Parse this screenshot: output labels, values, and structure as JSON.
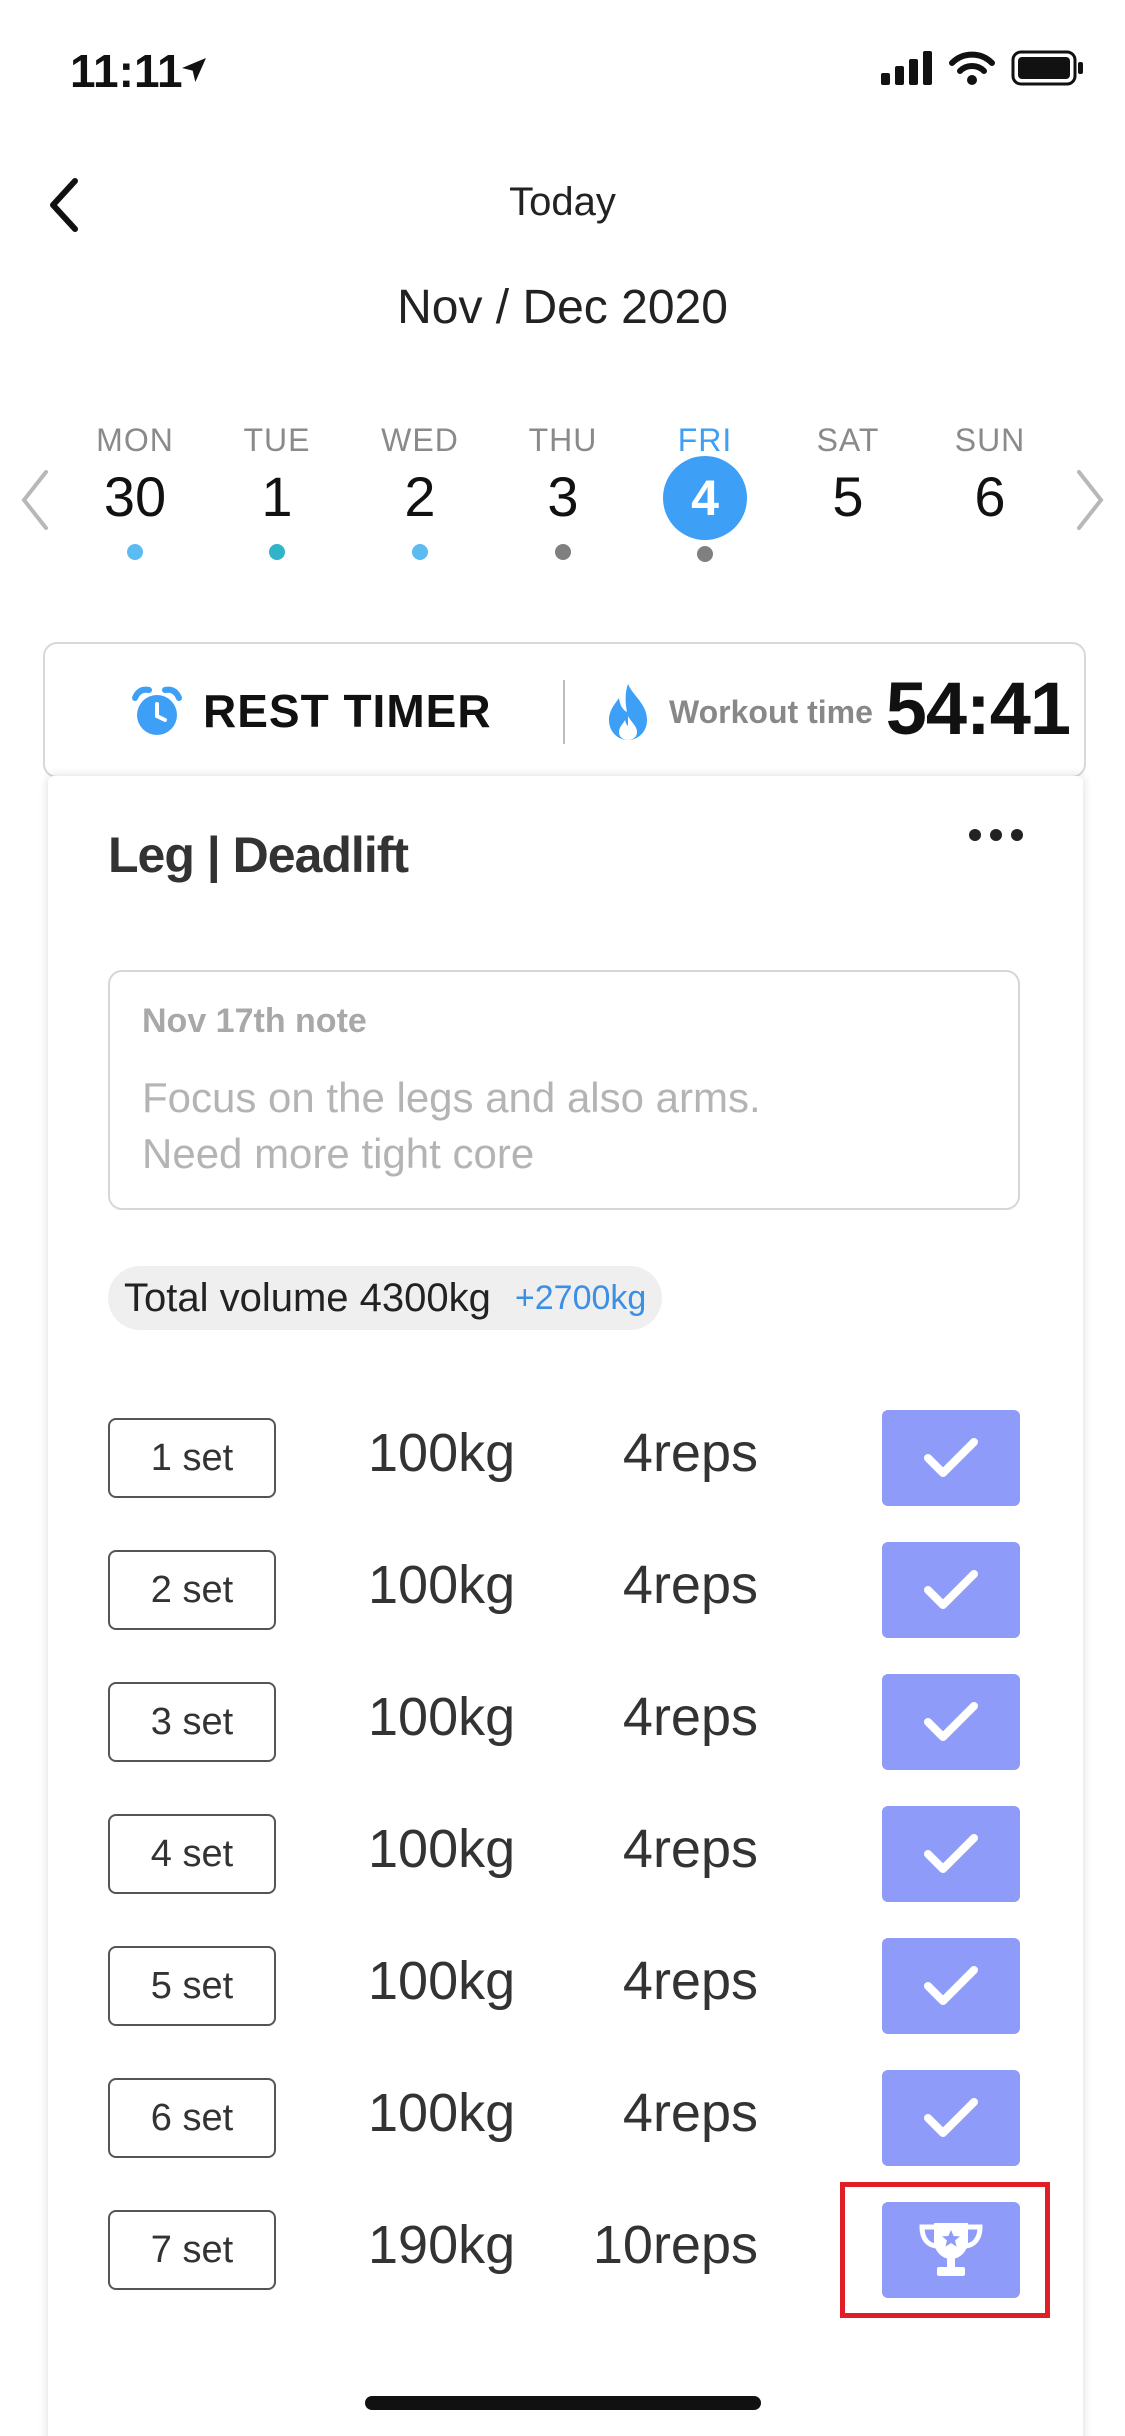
{
  "status_bar": {
    "time": "11:11"
  },
  "nav": {
    "title": "Today"
  },
  "month_label": "Nov / Dec 2020",
  "week": [
    {
      "name": "MON",
      "num": "30",
      "dot": "#5bbcf2"
    },
    {
      "name": "TUE",
      "num": "1",
      "dot": "#2fb4c9"
    },
    {
      "name": "WED",
      "num": "2",
      "dot": "#5bbcf2"
    },
    {
      "name": "THU",
      "num": "3",
      "dot": "#808080"
    },
    {
      "name": "FRI",
      "num": "4",
      "dot": "#808080",
      "selected": true
    },
    {
      "name": "SAT",
      "num": "5"
    },
    {
      "name": "SUN",
      "num": "6"
    }
  ],
  "timer": {
    "rest_label": "REST TIMER",
    "workout_label": "Workout time",
    "workout_value": "54:41"
  },
  "exercise": {
    "title": "Leg | Deadlift",
    "note_header": "Nov 17th  note",
    "note_line1": "Focus on the legs and also arms.",
    "note_line2": "Need more tight core",
    "volume_label": "Total volume 4300kg",
    "volume_diff": "+2700kg",
    "sets": [
      {
        "label": "1 set",
        "weight": "100kg",
        "reps": "4reps",
        "icon": "check-icon"
      },
      {
        "label": "2 set",
        "weight": "100kg",
        "reps": "4reps",
        "icon": "check-icon"
      },
      {
        "label": "3 set",
        "weight": "100kg",
        "reps": "4reps",
        "icon": "check-icon"
      },
      {
        "label": "4 set",
        "weight": "100kg",
        "reps": "4reps",
        "icon": "check-icon"
      },
      {
        "label": "5 set",
        "weight": "100kg",
        "reps": "4reps",
        "icon": "check-icon"
      },
      {
        "label": "6 set",
        "weight": "100kg",
        "reps": "4reps",
        "icon": "check-icon"
      },
      {
        "label": "7 set",
        "weight": "190kg",
        "reps": "10reps",
        "icon": "trophy-icon",
        "highlighted": true
      }
    ]
  },
  "colors": {
    "accent": "#3d9ff5",
    "set_button": "#8f9bf8",
    "volume_diff": "#3d8fe6",
    "highlight": "#e01e25"
  }
}
